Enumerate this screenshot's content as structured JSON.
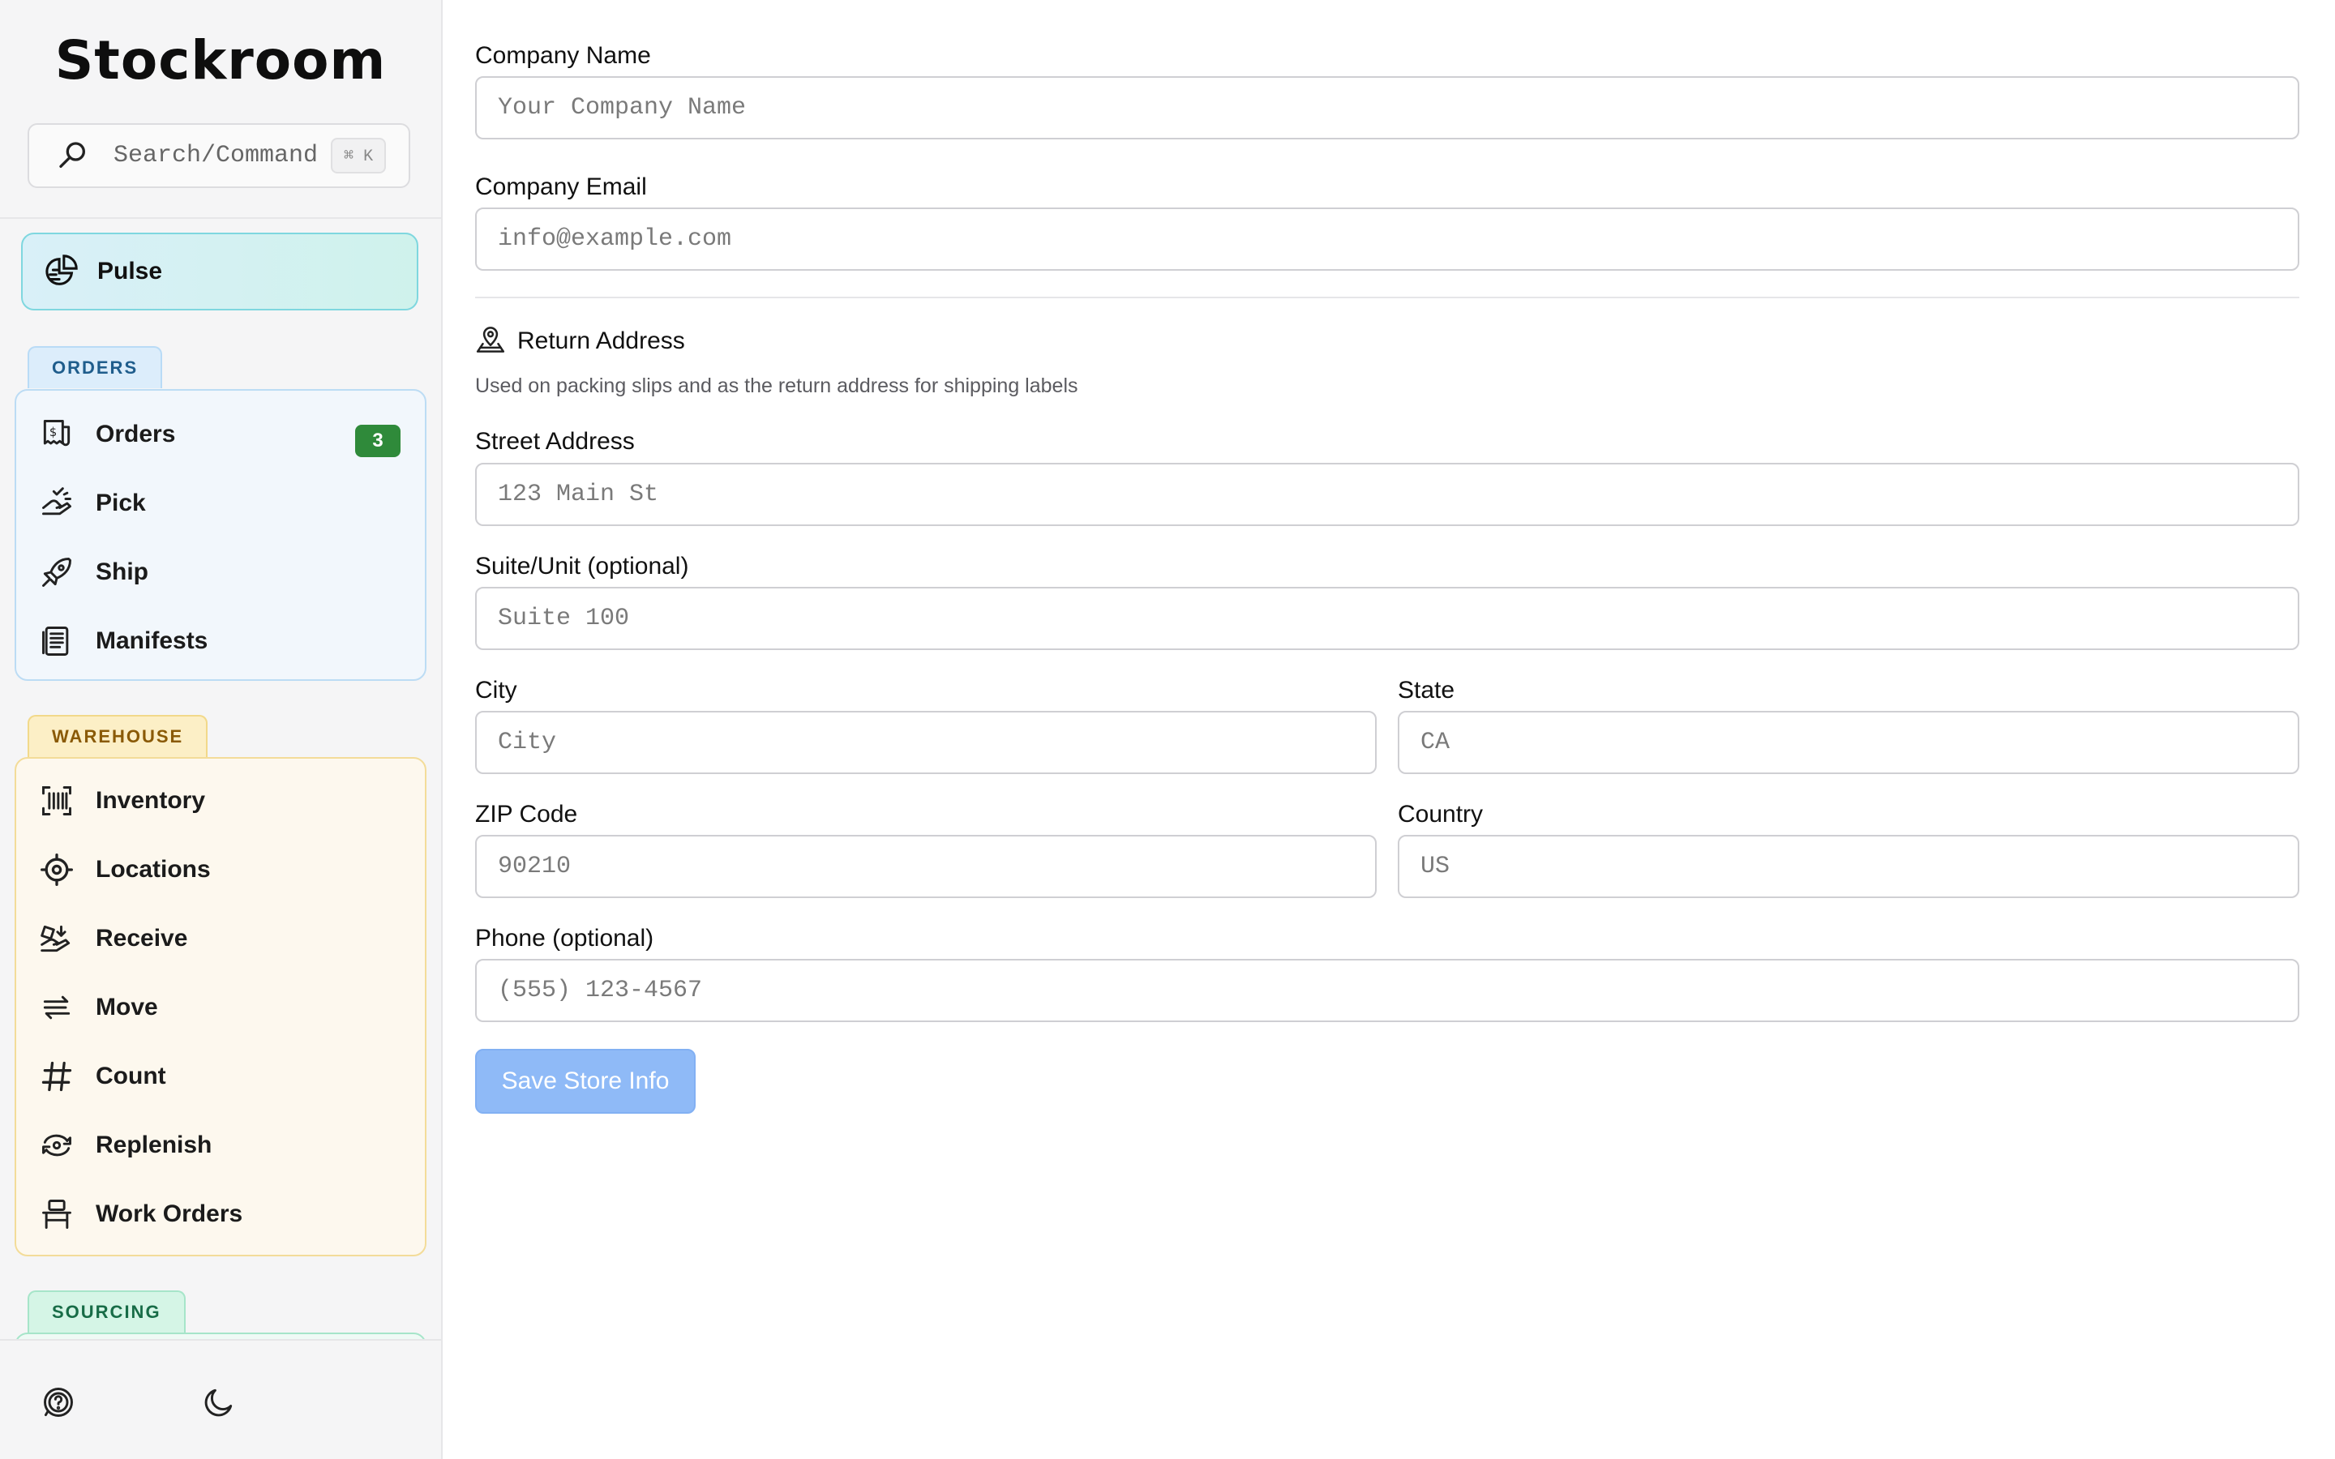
{
  "sidebar": {
    "logo": "Stockroom",
    "search": {
      "label": "Search/Command",
      "shortcut": "⌘ K"
    },
    "pulse": {
      "label": "Pulse",
      "icon": "pulse-chart-icon"
    },
    "groups": {
      "orders": {
        "label": "ORDERS",
        "items": [
          {
            "label": "Orders",
            "icon": "receipt-icon",
            "badge": "3"
          },
          {
            "label": "Pick",
            "icon": "hand-pick-icon"
          },
          {
            "label": "Ship",
            "icon": "rocket-icon"
          },
          {
            "label": "Manifests",
            "icon": "document-list-icon"
          }
        ]
      },
      "warehouse": {
        "label": "WAREHOUSE",
        "items": [
          {
            "label": "Inventory",
            "icon": "barcode-icon"
          },
          {
            "label": "Locations",
            "icon": "crosshair-icon"
          },
          {
            "label": "Receive",
            "icon": "receive-box-icon"
          },
          {
            "label": "Move",
            "icon": "move-arrows-icon"
          },
          {
            "label": "Count",
            "icon": "hash-icon"
          },
          {
            "label": "Replenish",
            "icon": "refresh-cycle-icon"
          },
          {
            "label": "Work Orders",
            "icon": "workbench-icon"
          }
        ]
      },
      "sourcing": {
        "label": "SOURCING"
      }
    },
    "footer": {
      "help_icon": "help-icon",
      "theme_icon": "moon-icon"
    }
  },
  "form": {
    "company_name": {
      "label": "Company Name",
      "placeholder": "Your Company Name"
    },
    "company_email": {
      "label": "Company Email",
      "placeholder": "info@example.com"
    },
    "return_address": {
      "title": "Return Address",
      "icon": "location-pin-icon",
      "description": "Used on packing slips and as the return address for shipping labels"
    },
    "street": {
      "label": "Street Address",
      "placeholder": "123 Main St"
    },
    "suite": {
      "label": "Suite/Unit (optional)",
      "placeholder": "Suite 100"
    },
    "city": {
      "label": "City",
      "placeholder": "City"
    },
    "state": {
      "label": "State",
      "placeholder": "CA"
    },
    "zip": {
      "label": "ZIP Code",
      "placeholder": "90210"
    },
    "country": {
      "label": "Country",
      "placeholder": "US"
    },
    "phone": {
      "label": "Phone (optional)",
      "placeholder": "(555) 123-4567"
    },
    "save_label": "Save Store Info"
  },
  "colors": {
    "accent_disabled": "#8fbaf7",
    "orders": "#dcedfb",
    "warehouse": "#fcefc6",
    "sourcing": "#d5f5e6",
    "badge": "#2f8a3a",
    "pulse": "#cff2ec"
  }
}
